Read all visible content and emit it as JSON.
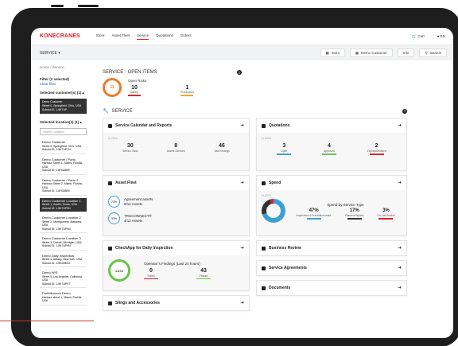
{
  "brand": "KONECRANES",
  "nav": {
    "items": [
      "Store",
      "Asset Fleet",
      "Service",
      "Quotations",
      "Orders"
    ],
    "cart": "Cart",
    "lang": "EN"
  },
  "subbar": {
    "title": "SERVICE",
    "year": "2024",
    "customer": "Demo Customer",
    "info": "Info",
    "search": "Search"
  },
  "sidebar": {
    "breadcrumb": "Home / Service",
    "filter_label": "Filter (2 selected)",
    "clear": "Clear filter",
    "cust_label": "Selected customer(s) (1)",
    "selected_customer": {
      "name": "Demo Customer",
      "line1": "Street 0, Springfield, Ohio, USA",
      "line2": "Subsid ID: 1-5K7AP"
    },
    "loc_label": "Selected location(s) (1)",
    "search_placeholder": "Search Locations",
    "locations": [
      {
        "name": "Demo Customer",
        "l1": "Street 0, Springfield, Ohio, USA",
        "l2": "Subsid ID: 1-5K7AP7N"
      },
      {
        "name": "Demo Customer / Porto",
        "l1": "Harbour Street 1, Miami, Florida, USA",
        "l2": "Subsid ID: 1-8H3J8B9"
      },
      {
        "name": "Demo Customer / Porto 2",
        "l1": "Harbour Street 2, Miami, Florida, USA",
        "l2": "Subsid ID: 1-8H3J8B9"
      },
      {
        "name": "Demo Customer Location 1",
        "l1": "Street 1, Austin, Texas, USA",
        "l2": "Subsid ID: 1-5K7AP9N"
      },
      {
        "name": "Demo Customer Location 2",
        "l1": "Street 2, Montgomery, Alabama, USA",
        "l2": "Subsid ID: 1-5K7AP9N"
      },
      {
        "name": "Demo Customer Location 3",
        "l1": "Street 3, Detroit, Michigan, USA",
        "l2": "Subsid ID: 1-5K7AP9N"
      },
      {
        "name": "Demo Daily Inspection",
        "l1": "Street 4, Albany, New York, USA",
        "l2": "Subsid ID: 1-5K2B5O2"
      },
      {
        "name": "Demo WIS",
        "l1": "Street 5, Los Angeles, California, USA",
        "l2": "Subsid ID: 1-5K7AP9T"
      },
      {
        "name": "Portfolioroom Demo",
        "l1": "Harbour street 1, Miami, Florida, USA",
        "l2": ""
      }
    ]
  },
  "open_items": {
    "title": "SERVICE - OPEN ITEMS",
    "risk_count": "11",
    "risk_label": "Open Risks",
    "safety_value": "10",
    "safety_label": "Safety",
    "production_value": "1",
    "production_label": "Production"
  },
  "service_title": "SERVICE",
  "calendar": {
    "title": "Service Calendar and Reports",
    "year": "In 2024",
    "visits": "30",
    "visits_label": "Service Visits",
    "assets": "8",
    "assets_label": "Assets Serviced",
    "findings": "46",
    "findings_label": "Total Findings"
  },
  "quotations": {
    "title": "Quotations",
    "year": "In 2024",
    "open": "3",
    "open_label": "Open",
    "approved": "4",
    "approved_label": "Approved",
    "expired": "2",
    "expired_label": "Expired/Declined"
  },
  "fleet": {
    "title": "Asset Fleet",
    "agree_pct": "73%",
    "agree_line1": "Agreement assets",
    "agree_line2": "9/12 Assets",
    "truc_pct": "33%",
    "truc_line1": "TRUCONNECT®",
    "truc_line2": "4/12 Assets"
  },
  "spend": {
    "title": "Spend",
    "year": "In 2024",
    "sub": "Spend by Service Type",
    "p1": "47%",
    "l1": "Inspections & Preventive maint.",
    "p2": "17%",
    "l2": "Planned Repairs",
    "p3": "3%",
    "l3": "On-Call Service"
  },
  "checkapp": {
    "title": "CheckApp for Daily Inspection",
    "sub": "Operator's Findings (Last 24 hours)",
    "ring": "43/43",
    "failed": "0",
    "failed_label": "Failed",
    "passed": "43",
    "passed_label": "Passed"
  },
  "business_review": {
    "title": "Business Review"
  },
  "agreements": {
    "title": "Service Agreements"
  },
  "documents": {
    "title": "Documents"
  },
  "slings": {
    "title": "Slings and Accessories"
  }
}
